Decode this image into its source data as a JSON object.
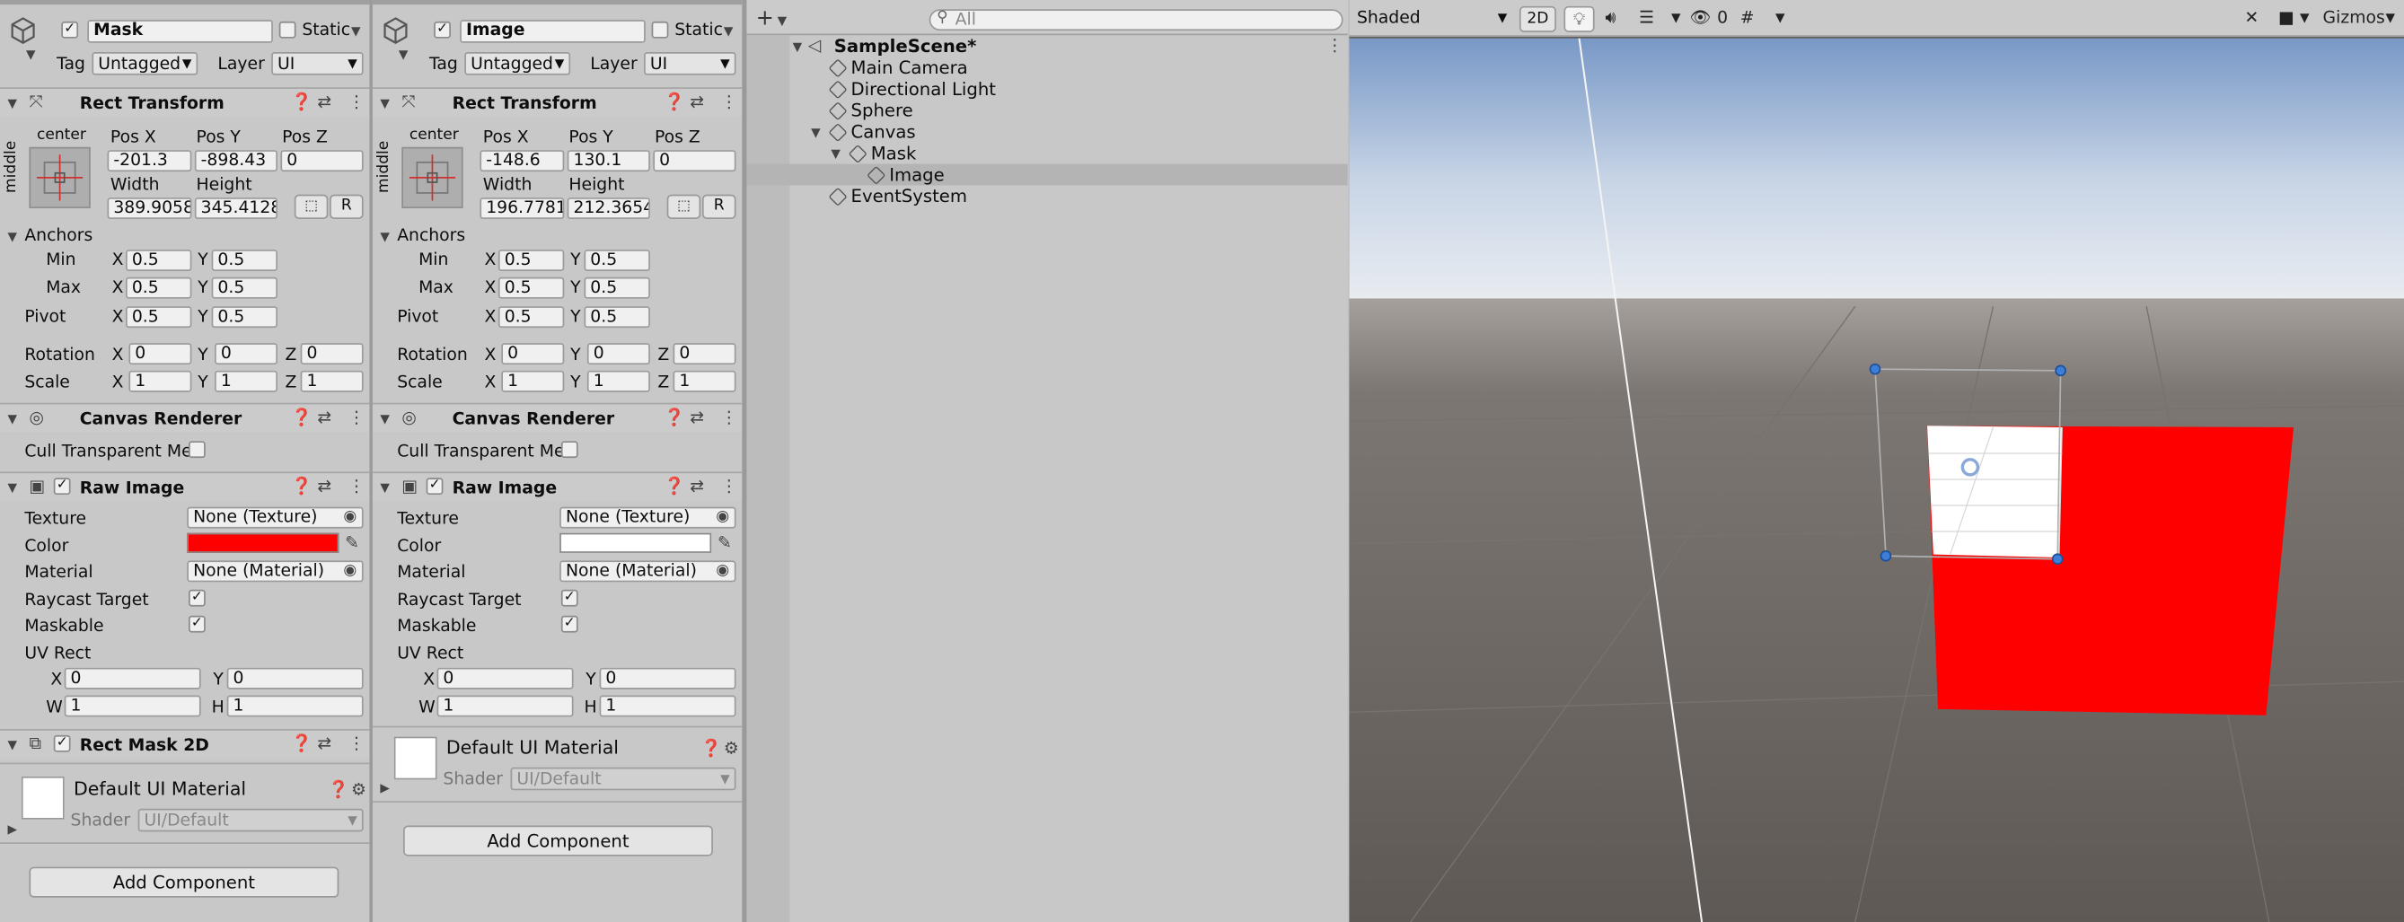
{
  "inspectors": [
    {
      "object_name": "Mask",
      "static_label": "Static",
      "tag_label": "Tag",
      "tag_value": "Untagged",
      "layer_label": "Layer",
      "layer_value": "UI",
      "rect_transform": {
        "title": "Rect Transform",
        "anchor_h": "center",
        "anchor_v": "middle",
        "posx_label": "Pos X",
        "posy_label": "Pos Y",
        "posz_label": "Pos Z",
        "posx": "-201.3",
        "posy": "-898.43",
        "posz": "0",
        "width_label": "Width",
        "height_label": "Height",
        "width": "389.9058",
        "height": "345.4128",
        "r_button": "R",
        "anchors_label": "Anchors",
        "min_label": "Min",
        "max_label": "Max",
        "pivot_label": "Pivot",
        "min_x": "0.5",
        "min_y": "0.5",
        "max_x": "0.5",
        "max_y": "0.5",
        "pivot_x": "0.5",
        "pivot_y": "0.5",
        "rotation_label": "Rotation",
        "rot_x": "0",
        "rot_y": "0",
        "rot_z": "0",
        "scale_label": "Scale",
        "scale_x": "1",
        "scale_y": "1",
        "scale_z": "1"
      },
      "canvas_renderer": {
        "title": "Canvas Renderer",
        "cull_label": "Cull Transparent Me"
      },
      "raw_image": {
        "title": "Raw Image",
        "texture_label": "Texture",
        "texture_value": "None (Texture)",
        "color_label": "Color",
        "color_value": "#ff0000",
        "material_label": "Material",
        "material_value": "None (Material)",
        "raycast_label": "Raycast Target",
        "maskable_label": "Maskable",
        "uvrect_label": "UV Rect",
        "uv_x": "0",
        "uv_y": "0",
        "uv_w": "1",
        "uv_h": "1"
      },
      "extra_component": "Rect Mask 2D",
      "material": {
        "name": "Default UI Material",
        "shader_label": "Shader",
        "shader_value": "UI/Default"
      },
      "add_component": "Add Component"
    },
    {
      "object_name": "Image",
      "static_label": "Static",
      "tag_label": "Tag",
      "tag_value": "Untagged",
      "layer_label": "Layer",
      "layer_value": "UI",
      "rect_transform": {
        "title": "Rect Transform",
        "anchor_h": "center",
        "anchor_v": "middle",
        "posx_label": "Pos X",
        "posy_label": "Pos Y",
        "posz_label": "Pos Z",
        "posx": "-148.6",
        "posy": "130.1",
        "posz": "0",
        "width_label": "Width",
        "height_label": "Height",
        "width": "196.7781",
        "height": "212.3654",
        "r_button": "R",
        "anchors_label": "Anchors",
        "min_label": "Min",
        "max_label": "Max",
        "pivot_label": "Pivot",
        "min_x": "0.5",
        "min_y": "0.5",
        "max_x": "0.5",
        "max_y": "0.5",
        "pivot_x": "0.5",
        "pivot_y": "0.5",
        "rotation_label": "Rotation",
        "rot_x": "0",
        "rot_y": "0",
        "rot_z": "0",
        "scale_label": "Scale",
        "scale_x": "1",
        "scale_y": "1",
        "scale_z": "1"
      },
      "canvas_renderer": {
        "title": "Canvas Renderer",
        "cull_label": "Cull Transparent Me"
      },
      "raw_image": {
        "title": "Raw Image",
        "texture_label": "Texture",
        "texture_value": "None (Texture)",
        "color_label": "Color",
        "color_value": "#ffffff",
        "material_label": "Material",
        "material_value": "None (Material)",
        "raycast_label": "Raycast Target",
        "maskable_label": "Maskable",
        "uvrect_label": "UV Rect",
        "uv_x": "0",
        "uv_y": "0",
        "uv_w": "1",
        "uv_h": "1"
      },
      "material": {
        "name": "Default UI Material",
        "shader_label": "Shader",
        "shader_value": "UI/Default"
      },
      "add_component": "Add Component"
    }
  ],
  "hierarchy": {
    "search_placeholder": "All",
    "scene_name": "SampleScene*",
    "items": [
      "Main Camera",
      "Directional Light",
      "Sphere",
      "Canvas",
      "Mask",
      "Image",
      "EventSystem"
    ],
    "selected": "Image"
  },
  "scene": {
    "shading": "Shaded",
    "mode_2d": "2D",
    "hidden_count": "0",
    "gizmos": "Gizmos"
  },
  "colors": {
    "mask_fill": "#ff0000",
    "image_fill": "#ffffff",
    "handle": "#3d7fd8"
  }
}
